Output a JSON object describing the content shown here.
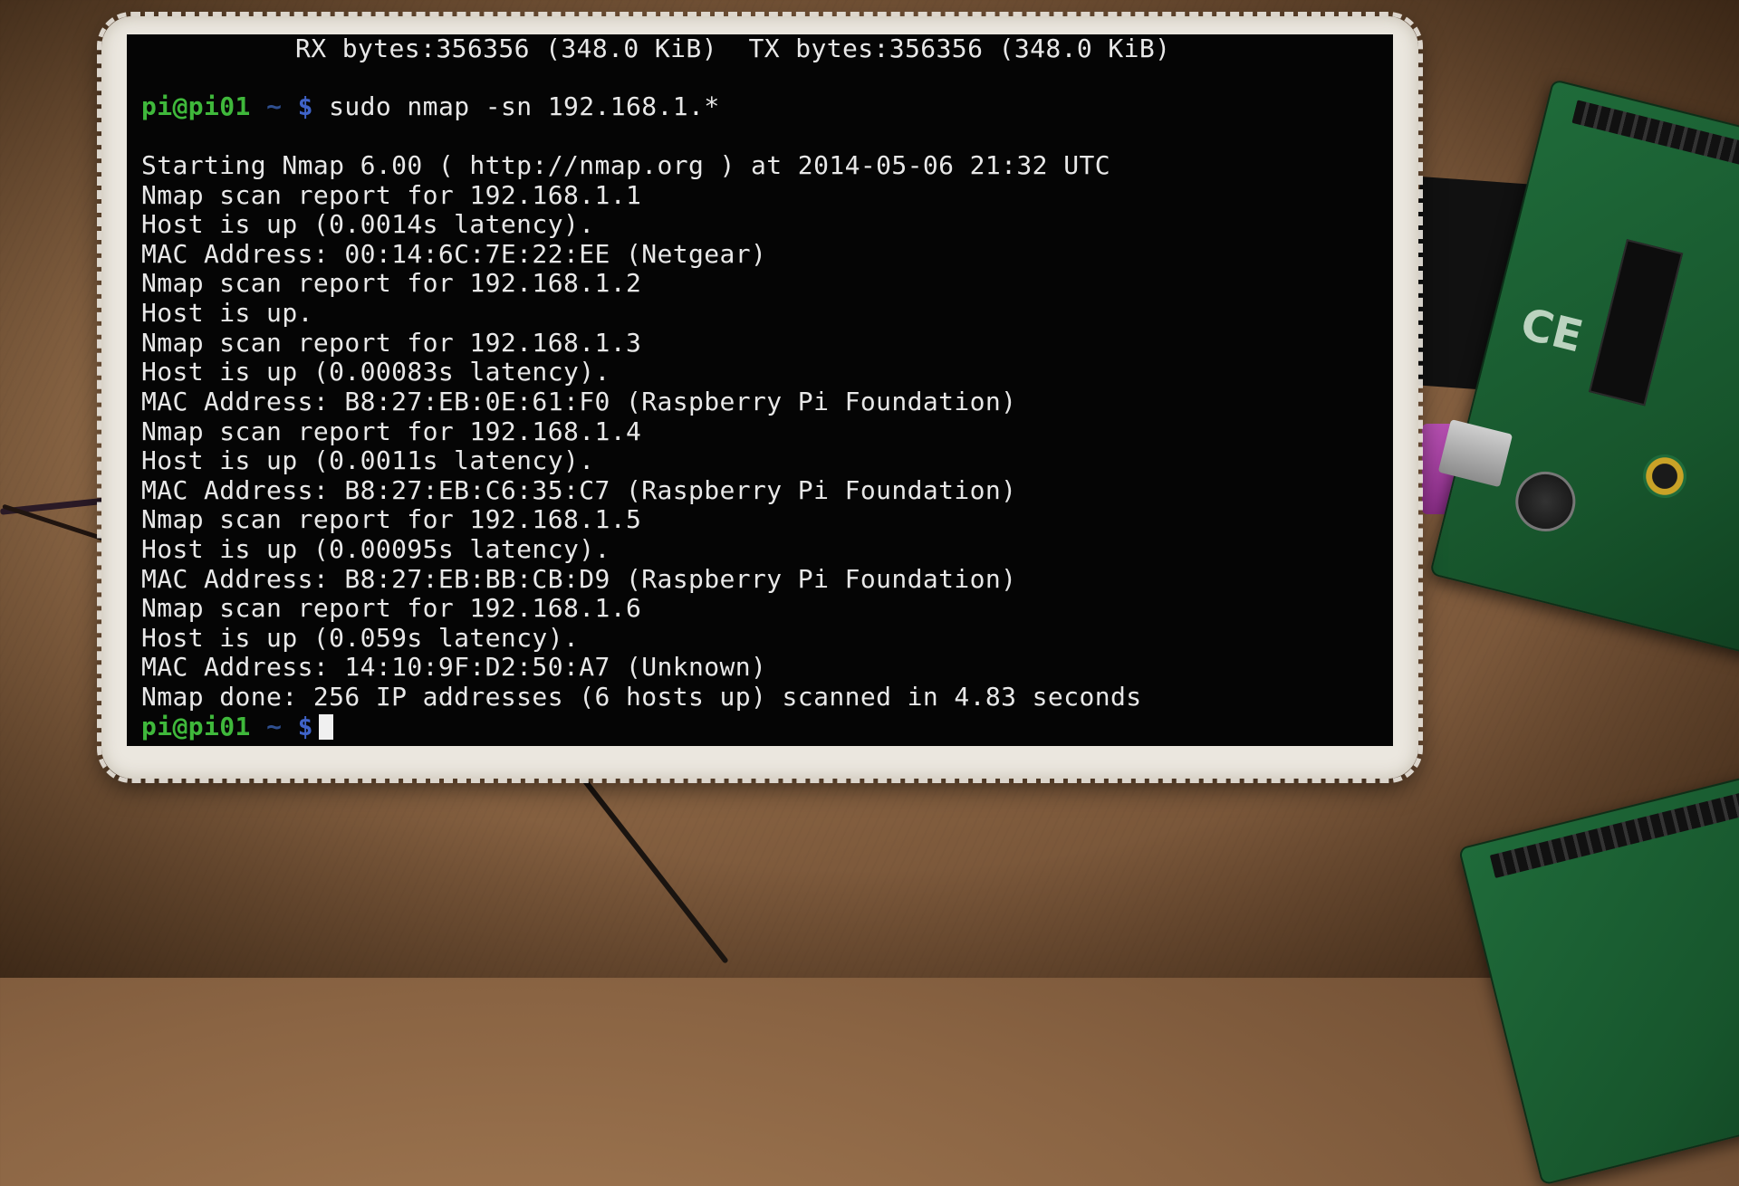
{
  "terminal": {
    "header_line": "RX bytes:356356 (348.0 KiB)  TX bytes:356356 (348.0 KiB)",
    "prompt": {
      "user_host": "pi@pi01",
      "tilde": "~",
      "dollar": "$"
    },
    "command": "sudo nmap -sn 192.168.1.*",
    "output": [
      "Starting Nmap 6.00 ( http://nmap.org ) at 2014-05-06 21:32 UTC",
      "Nmap scan report for 192.168.1.1",
      "Host is up (0.0014s latency).",
      "MAC Address: 00:14:6C:7E:22:EE (Netgear)",
      "Nmap scan report for 192.168.1.2",
      "Host is up.",
      "Nmap scan report for 192.168.1.3",
      "Host is up (0.00083s latency).",
      "MAC Address: B8:27:EB:0E:61:F0 (Raspberry Pi Foundation)",
      "Nmap scan report for 192.168.1.4",
      "Host is up (0.0011s latency).",
      "MAC Address: B8:27:EB:C6:35:C7 (Raspberry Pi Foundation)",
      "Nmap scan report for 192.168.1.5",
      "Host is up (0.00095s latency).",
      "MAC Address: B8:27:EB:BB:CB:D9 (Raspberry Pi Foundation)",
      "Nmap scan report for 192.168.1.6",
      "Host is up (0.059s latency).",
      "MAC Address: 14:10:9F:D2:50:A7 (Unknown)",
      "Nmap done: 256 IP addresses (6 hosts up) scanned in 4.83 seconds"
    ],
    "colors": {
      "background": "#050505",
      "text": "#e8e8e8",
      "prompt_user": "#3fb83b",
      "prompt_symbol": "#3f63c8"
    }
  },
  "board_silkscreen": "CE"
}
